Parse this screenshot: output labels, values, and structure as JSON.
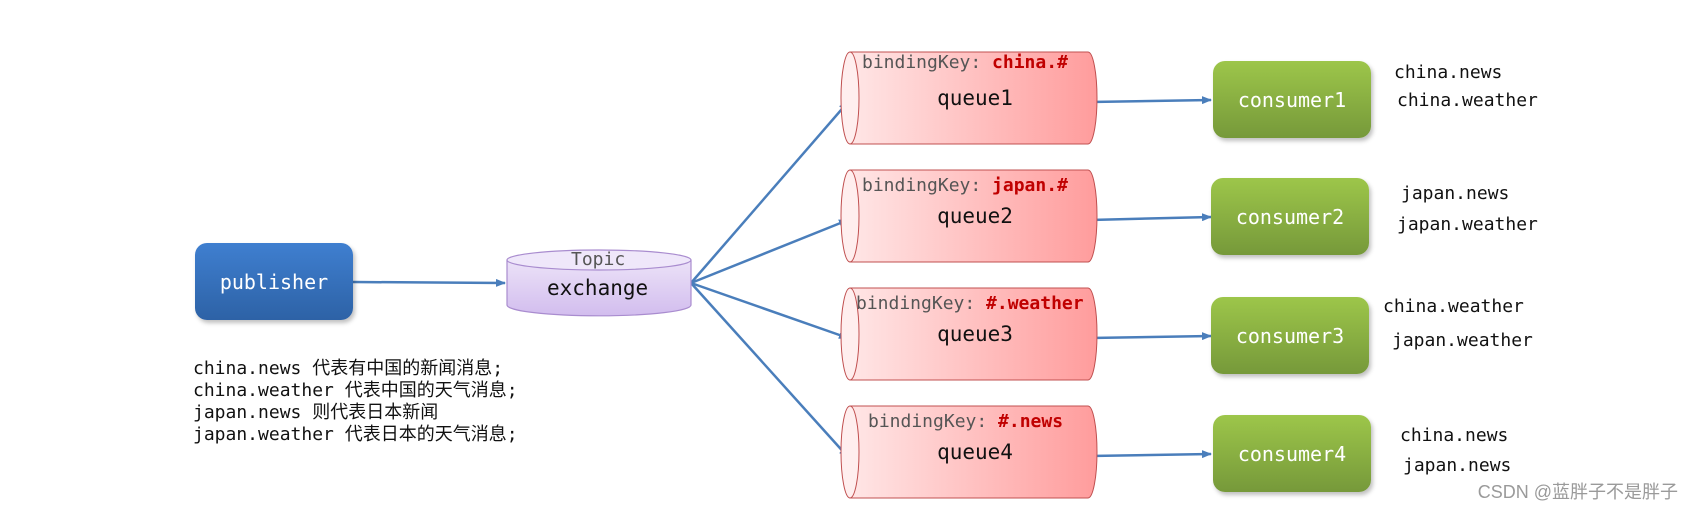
{
  "publisher": {
    "label": "publisher"
  },
  "exchange": {
    "type_label": "Topic",
    "label": "exchange"
  },
  "description": [
    "china.news 代表有中国的新闻消息;",
    "china.weather 代表中国的天气消息;",
    "japan.news 则代表日本新闻",
    "japan.weather 代表日本的天气消息;"
  ],
  "queues": [
    {
      "name": "queue1",
      "binding_prefix": "bindingKey: ",
      "binding_key": "china.#"
    },
    {
      "name": "queue2",
      "binding_prefix": "bindingKey: ",
      "binding_key": "japan.#"
    },
    {
      "name": "queue3",
      "binding_prefix": "bindingKey: ",
      "binding_key": "#.weather"
    },
    {
      "name": "queue4",
      "binding_prefix": "bindingKey: ",
      "binding_key": "#.news"
    }
  ],
  "consumers": [
    {
      "name": "consumer1",
      "receives": [
        "china.news",
        "china.weather"
      ]
    },
    {
      "name": "consumer2",
      "receives": [
        "japan.news",
        "japan.weather"
      ]
    },
    {
      "name": "consumer3",
      "receives": [
        "china.weather",
        "japan.weather"
      ]
    },
    {
      "name": "consumer4",
      "receives": [
        "china.news",
        "japan.news"
      ]
    }
  ],
  "watermark": "CSDN @蓝胖子不是胖子",
  "colors": {
    "arrow": "#4a7ebb",
    "publisher": "#3470c0",
    "consumer": "#8ab43f",
    "queue": "#ff9c9c",
    "exchange": "#dccaf0",
    "binding_key": "#c00000"
  }
}
